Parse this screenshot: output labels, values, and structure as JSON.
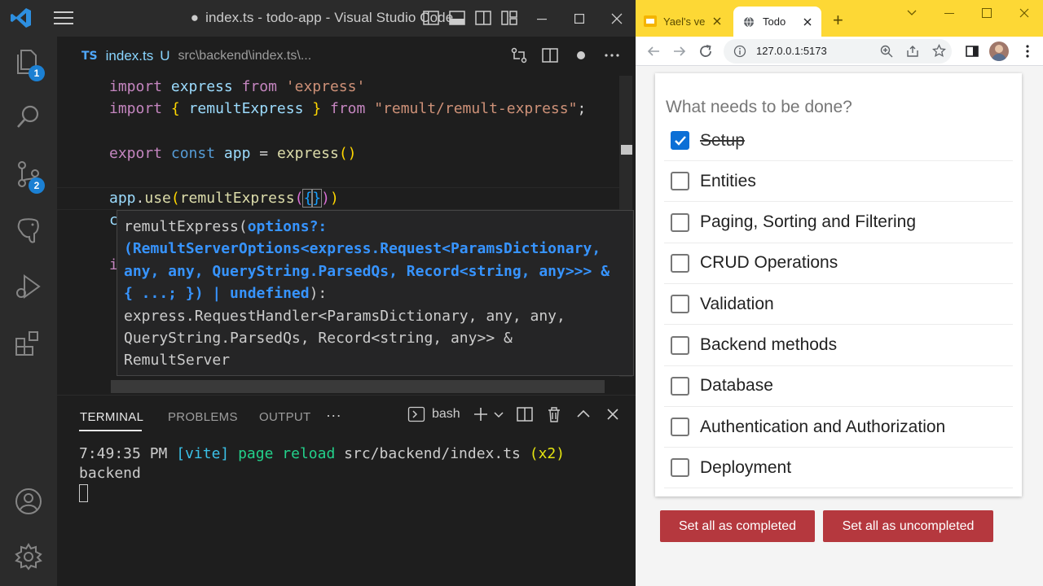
{
  "vscode": {
    "title": "index.ts - todo-app - Visual Studio Code",
    "title_dot": "●",
    "activity": {
      "explorer_badge": "1",
      "scm_badge": "2"
    },
    "tab": {
      "lang_badge": "TS",
      "filename": "index.ts",
      "status": "U",
      "path": "src\\backend\\index.ts\\..."
    },
    "code": {
      "l1": [
        "import",
        "express",
        "from",
        "'express'"
      ],
      "l2": [
        "import",
        "{",
        "remultExpress",
        "}",
        "from",
        "\"remult/remult-express\"",
        ";"
      ],
      "l4": [
        "export",
        "const",
        "app",
        "=",
        "express",
        "()"
      ],
      "l6": [
        "app",
        ".",
        "use",
        "(",
        "remultExpress",
        "(",
        "{",
        "}",
        ")",
        ")"
      ],
      "l7": "c",
      "l9": "i"
    },
    "hover": {
      "line1_a": "remultExpress(",
      "line1_b": "options?:",
      "line2": "(RemultServerOptions<express.Request<ParamsDictionary,",
      "line3": "any, any, QueryString.ParsedQs, Record<string, any>>> &",
      "line4": "{ ...; }) | undefined",
      "line4_end": "):",
      "line5": "express.RequestHandler<ParamsDictionary, any, any,",
      "line6": "QueryString.ParsedQs, Record<string, any>> &",
      "line7": "RemultServer"
    },
    "panel": {
      "tabs": [
        "TERMINAL",
        "PROBLEMS",
        "OUTPUT"
      ],
      "more": "···",
      "shell": "bash"
    },
    "terminal": {
      "time": "7:49:35 PM",
      "tag": "[vite]",
      "msg": "page reload",
      "file": "src/backend/index.ts",
      "count": "(x2)",
      "line2": "backend"
    }
  },
  "browser": {
    "tabs": [
      {
        "label": "Yael's ve",
        "active": false
      },
      {
        "label": "Todo",
        "active": true
      }
    ],
    "url": "127.0.0.1:5173",
    "todo": {
      "placeholder": "What needs to be done?",
      "items": [
        {
          "label": "Setup",
          "completed": true
        },
        {
          "label": "Entities",
          "completed": false
        },
        {
          "label": "Paging, Sorting and Filtering",
          "completed": false
        },
        {
          "label": "CRUD Operations",
          "completed": false
        },
        {
          "label": "Validation",
          "completed": false
        },
        {
          "label": "Backend methods",
          "completed": false
        },
        {
          "label": "Database",
          "completed": false
        },
        {
          "label": "Authentication and Authorization",
          "completed": false
        },
        {
          "label": "Deployment",
          "completed": false
        }
      ],
      "set_all_completed": "Set all as completed",
      "set_all_uncompleted": "Set all as uncompleted"
    }
  },
  "colors": {
    "vscode_bg": "#1e1e1e",
    "chrome_accent": "#fdd835",
    "button_red": "#b5383e",
    "checkbox_blue": "#0b6fd6"
  }
}
